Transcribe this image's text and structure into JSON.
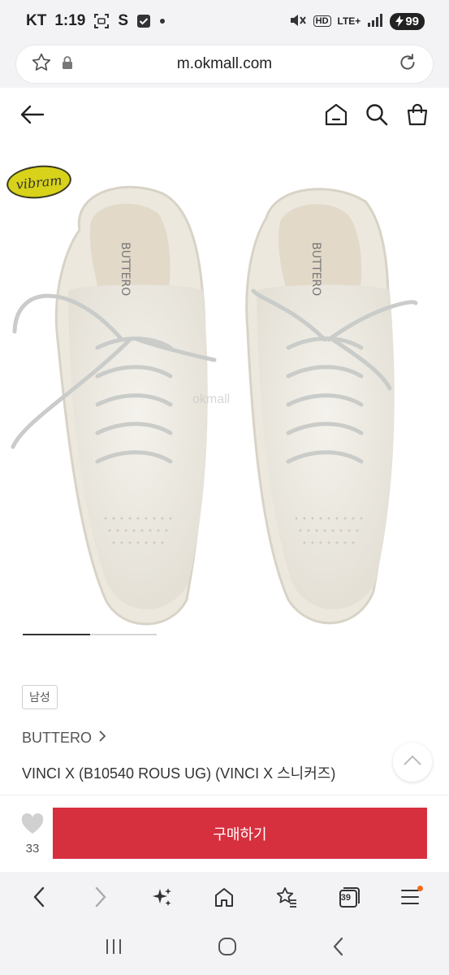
{
  "status_bar": {
    "carrier": "KT",
    "time": "1:19",
    "app_icon_s": "S",
    "network": "LTE+",
    "hd": "HD",
    "battery": "99"
  },
  "browser": {
    "url": "m.okmall.com"
  },
  "product": {
    "image_badge": "vibram",
    "watermark": "okmall",
    "gallery_progress": 0.5,
    "gender_tag": "남성",
    "brand": "BUTTERO",
    "name": "VINCI X (B10540 ROUS UG) (VINCI X 스니커즈)"
  },
  "purchase_bar": {
    "like_count": "33",
    "buy_label": "구매하기"
  },
  "browser_toolbar": {
    "tabs_count": "39"
  },
  "colors": {
    "accent": "#d6303f",
    "chrome_bg": "#f3f3f6",
    "badge": "#d8d21a",
    "notification_dot": "#f06a1a"
  }
}
